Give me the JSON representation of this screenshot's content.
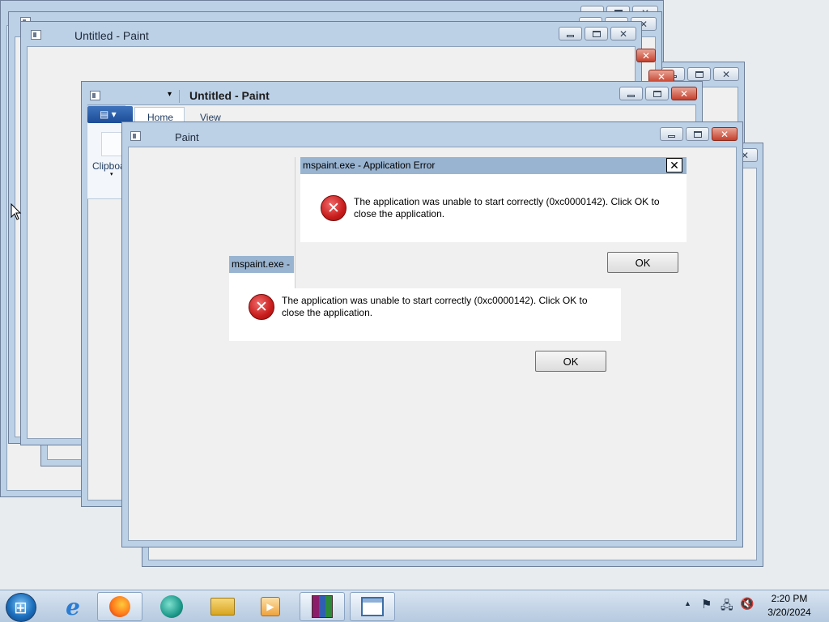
{
  "windows": {
    "back_top_title": "",
    "back_paint_title": "Untitled - Paint",
    "ribbon_paint_title": "Untitled - Paint",
    "front_paint_title": "Paint",
    "ribbon_tabs": [
      "Home",
      "View"
    ],
    "ribbon_group_clipboard": "Clipboa"
  },
  "dialog_front": {
    "title": "mspaint.exe - Application Error",
    "message_line1": "The application was unable to start correctly (0xc0000142). Click OK to",
    "message_line2": "close the application.",
    "ok_label": "OK",
    "close_glyph": "✕"
  },
  "dialog_back": {
    "title": "mspaint.exe - A",
    "message_line1": "The application was unable to start correctly (0xc0000142). Click OK to",
    "message_line2": "close the application.",
    "ok_label": "OK"
  },
  "taskbar": {
    "time": "2:20 PM",
    "date": "3/20/2024",
    "pinned": [
      {
        "name": "internet-explorer-icon",
        "glyph": "e",
        "color": "#2b7cd3"
      },
      {
        "name": "firefox-icon",
        "glyph": "🦊",
        "color": "#e66000"
      },
      {
        "name": "media-app-icon",
        "glyph": "◐",
        "color": "#1d9a8b"
      },
      {
        "name": "file-explorer-icon",
        "glyph": "📁",
        "color": "#d9a520"
      },
      {
        "name": "media-player-icon",
        "glyph": "▶",
        "color": "#e57a1c"
      },
      {
        "name": "winrar-icon",
        "glyph": "📚",
        "color": "#8b1e6b"
      },
      {
        "name": "paint-window-icon",
        "glyph": "▣",
        "color": "#3a6ea5"
      }
    ]
  },
  "colors": {
    "title_active": "#99b4d1",
    "error_red": "#c81c1c",
    "close_red": "#c4402c"
  }
}
